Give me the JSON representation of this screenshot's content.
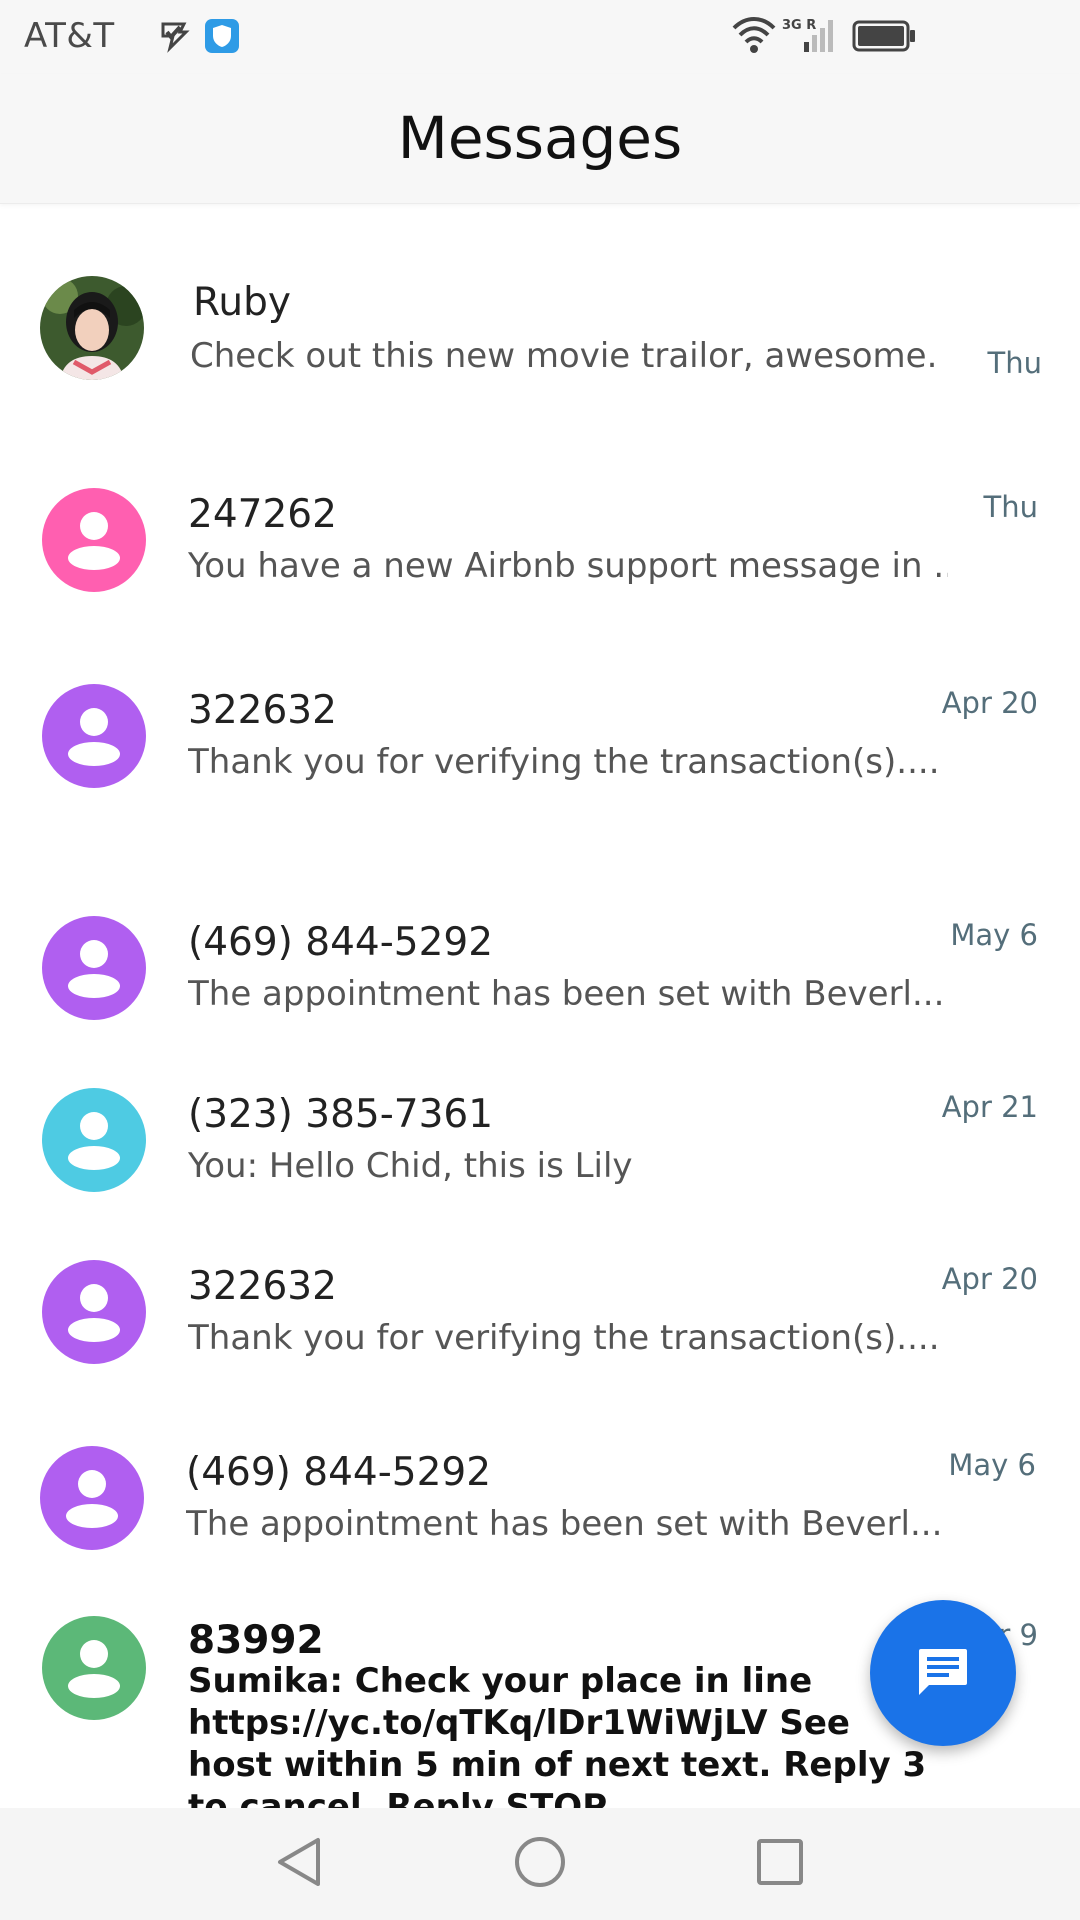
{
  "status_bar": {
    "carrier": "AT&T",
    "network": "3G R",
    "icons": [
      "check-notification-icon",
      "shield-icon",
      "wifi-icon",
      "signal-icon",
      "battery-icon"
    ]
  },
  "app_bar": {
    "title": "Messages"
  },
  "conversations": [
    {
      "name": "Ruby",
      "snippet": "Check out this new movie trailor, awesome.",
      "time": "Thu",
      "avatar": "photo",
      "unread": false
    },
    {
      "name": "247262",
      "snippet": "You have a new Airbnb support message in ...",
      "time": "Thu",
      "avatar_color": "#ff5fb0",
      "unread": false
    },
    {
      "name": "322632",
      "snippet": "Thank you for verifying the transaction(s)....",
      "time": "Apr 20",
      "avatar_color": "#b05ff0",
      "unread": false
    },
    {
      "name": "(469) 844-5292",
      "snippet": "The appointment has been set with Beverl...",
      "time": "May 6",
      "avatar_color": "#b05ff0",
      "unread": false
    },
    {
      "name": "(323) 385-7361",
      "snippet": "You: Hello Chid, this is Lily",
      "time": "Apr 21",
      "avatar_color": "#4ecbe3",
      "unread": false
    },
    {
      "name": "322632",
      "snippet": "Thank you for verifying the transaction(s)....",
      "time": "Apr 20",
      "avatar_color": "#b05ff0",
      "unread": false
    },
    {
      "name": "(469) 844-5292",
      "snippet": "The appointment has been set with Beverl...",
      "time": "May 6",
      "avatar_color": "#b05ff0",
      "unread": false
    },
    {
      "name": "83992",
      "snippet": "Sumika: Check your place in line https://yc.to/qTKq/lDr1WiWjLV See host within 5 min of next text. Reply 3 to cancel. Reply STOP...",
      "time": "r 9",
      "avatar_color": "#5cb878",
      "unread": true
    }
  ],
  "fab": {
    "icon": "new-message-icon",
    "color": "#1a73e8"
  },
  "nav_bar": {
    "icons": [
      "back-triangle-icon",
      "home-circle-icon",
      "recents-square-icon"
    ]
  }
}
